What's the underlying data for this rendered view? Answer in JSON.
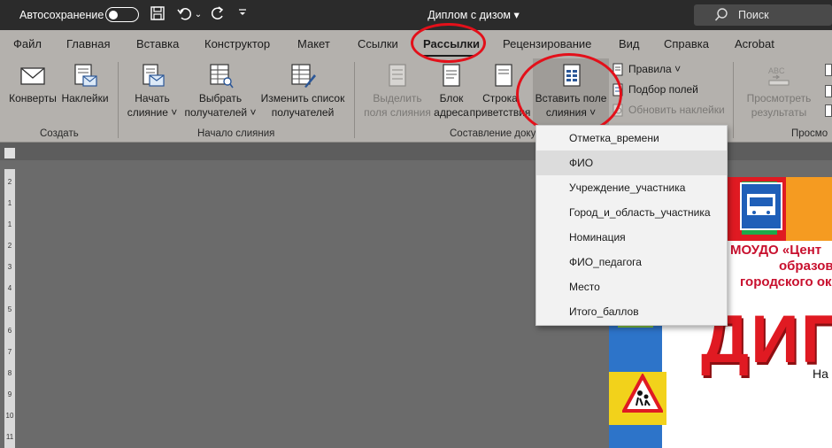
{
  "titlebar": {
    "autosave_label": "Автосохранение",
    "doc_title": "Диплом с дизом",
    "search_label": "Поиск"
  },
  "tabs": [
    {
      "label": "Файл"
    },
    {
      "label": "Главная"
    },
    {
      "label": "Вставка"
    },
    {
      "label": "Конструктор"
    },
    {
      "label": "Макет"
    },
    {
      "label": "Ссылки"
    },
    {
      "label": "Рассылки"
    },
    {
      "label": "Рецензирование"
    },
    {
      "label": "Вид"
    },
    {
      "label": "Справка"
    },
    {
      "label": "Acrobat"
    }
  ],
  "ribbon": {
    "envelopes": "Конверты",
    "labels": "Наклейки",
    "start_merge_1": "Начать",
    "start_merge_2": "слияние",
    "select_recipients_1": "Выбрать",
    "select_recipients_2": "получателей",
    "edit_list_1": "Изменить список",
    "edit_list_2": "получателей",
    "highlight_fields_1": "Выделить",
    "highlight_fields_2": "поля слияния",
    "address_block_1": "Блок",
    "address_block_2": "адреса",
    "greeting_line_1": "Строка",
    "greeting_line_2": "приветствия",
    "insert_field_1": "Вставить поле",
    "insert_field_2": "слияния",
    "rules": "Правила",
    "match_fields": "Подбор полей",
    "update_labels": "Обновить наклейки",
    "preview_1": "Просмотреть",
    "preview_2": "результаты",
    "group_create": "Создать",
    "group_start": "Начало слияния",
    "group_compose": "Составление доку",
    "group_preview": "Просмо"
  },
  "merge_fields": [
    {
      "label": "Отметка_времени"
    },
    {
      "label": "ФИО"
    },
    {
      "label": "Учреждение_участника"
    },
    {
      "label": "Город_и_область_участника"
    },
    {
      "label": "Номинация"
    },
    {
      "label": "ФИО_педагога"
    },
    {
      "label": "Место"
    },
    {
      "label": "Итого_баллов"
    }
  ],
  "document": {
    "org_line1": "МОУДО «Цент",
    "org_line2": "образов",
    "org_line3": "городского ок",
    "big_title": "ДИП",
    "nag": "На"
  },
  "vertical_ruler": [
    "2",
    "1",
    "1",
    "2",
    "3",
    "4",
    "5",
    "6",
    "7",
    "8",
    "9",
    "10",
    "11"
  ],
  "colors": {
    "titlebar": "#2b2b2b",
    "ribbon": "#b4b1ad",
    "annotation": "#e3101a",
    "diploma_red": "#e01a22"
  }
}
